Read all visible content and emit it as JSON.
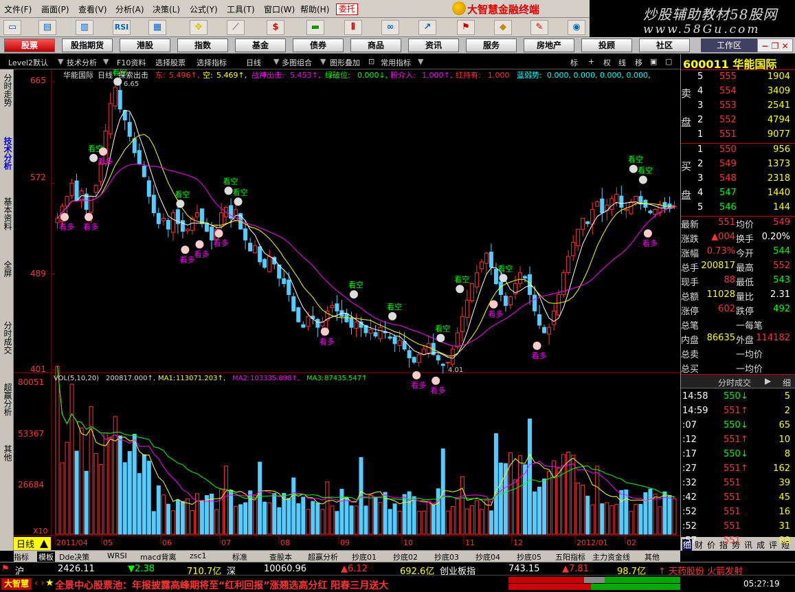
{
  "menu": [
    "文件(F)",
    "画面(P)",
    "查看(V)",
    "分析(A)",
    "决策(L)",
    "公式(Y)",
    "工具(T)",
    "窗口(W)",
    "帮助(H)"
  ],
  "weituo": "委托",
  "brand": "大智慧金融终端",
  "watermark": {
    "line1": "炒股辅助教材58股网",
    "line2": "www.58Gu.com"
  },
  "toolbar_icons": [
    "open-icon",
    "window-icon",
    "kline-icon",
    "rsi-icon",
    "table-icon",
    "move-icon",
    "ruler-icon",
    "dollar-icon",
    "flag-icon",
    "bars-icon",
    "binocular-icon",
    "signal-icon",
    "alert-icon",
    "diamond-icon",
    "shuffle-icon",
    "globe-icon",
    "window2-icon"
  ],
  "toolbar_rsi": "RSI",
  "toolbar_dollar": "$",
  "nav": [
    "股票",
    "股指期货",
    "港股",
    "指数",
    "基金",
    "债券",
    "商品",
    "资讯",
    "服务",
    "房地产",
    "投顾",
    "社区"
  ],
  "workarea": "工作区",
  "subbar": {
    "level2": "Level2默认",
    "tech": "技术分析",
    "f10": "F10资料",
    "select": "选择股票",
    "indicator": "选择指标",
    "day": "日线",
    "multi": "多图组合",
    "overlay": "图形叠加",
    "common": "常用指标",
    "tag": "标",
    "plus": "+",
    "quan": "权",
    "xian": "线",
    "move": "移"
  },
  "left_tabs": [
    "分时走势",
    "技术分析",
    "基本资料",
    "全屏",
    "分时成交",
    "超赢分析",
    "其他"
  ],
  "chart_header": {
    "name": "华能国际",
    "period": "日线",
    "ind1": "探索出击",
    "dong": "东:",
    "dong_v": "5.496↑,",
    "kong": "空:",
    "kong_v": "5.469↑,",
    "zhan": "战神出击:",
    "zhan_v": "5.453↑,",
    "lv": "绿破位:",
    "lv_v": "0.000↓,",
    "fen": "粉介入:",
    "fen_v": "1.000↑,",
    "hong": "红持有:",
    "hong_v": "1.000",
    "lan": "蓝弱势:",
    "lan_v": "0.000, 0.000, 0.000, 0.000,"
  },
  "price_axis": [
    "665",
    "572",
    "489",
    "401"
  ],
  "high_label": "6.65",
  "low_label": "4.01",
  "vol_header": {
    "vol": "VOL(5,10,20)",
    "vol_v": "200817.000↑,",
    "ma1": "MA1:",
    "ma1_v": "113071.203↑,",
    "ma2": "MA2:",
    "ma2_v": "103335.898↑,",
    "ma3": "MA3:",
    "ma3_v": "87435.547↑"
  },
  "vol_axis": [
    "80051",
    "53367",
    "26684"
  ],
  "vol_x10": "X10",
  "date_axis": [
    "2011/04",
    "05",
    "06",
    "07",
    "08",
    "09",
    "10",
    "11",
    "12",
    "2012/01",
    "02"
  ],
  "signals": {
    "bear": "看空",
    "bull": "看多"
  },
  "right": {
    "code": "600011",
    "name": "华能国际",
    "sell_label": [
      "卖",
      "盘"
    ],
    "buy_label": [
      "买",
      "盘"
    ],
    "asks": [
      {
        "n": "5",
        "p": "555",
        "v": "1904"
      },
      {
        "n": "4",
        "p": "554",
        "v": "3409"
      },
      {
        "n": "3",
        "p": "553",
        "v": "2541"
      },
      {
        "n": "2",
        "p": "552",
        "v": "4794"
      },
      {
        "n": "1",
        "p": "551",
        "v": "9077"
      }
    ],
    "bids": [
      {
        "n": "1",
        "p": "550",
        "v": "956"
      },
      {
        "n": "2",
        "p": "549",
        "v": "1373"
      },
      {
        "n": "3",
        "p": "548",
        "v": "2318"
      },
      {
        "n": "4",
        "p": "547",
        "v": "1440"
      },
      {
        "n": "5",
        "p": "546",
        "v": "144"
      }
    ],
    "stats": [
      {
        "l1": "最新",
        "v1": "551",
        "l2": "均价",
        "v2": "549",
        "c1": "red",
        "c2": "red"
      },
      {
        "l1": "涨跌",
        "v1": "▲004",
        "l2": "换手",
        "v2": "0.20%",
        "c1": "red",
        "c2": "wht"
      },
      {
        "l1": "涨幅",
        "v1": "0.73%",
        "l2": "今开",
        "v2": "544",
        "c1": "red",
        "c2": "grn"
      },
      {
        "l1": "总手",
        "v1": "200817",
        "l2": "最高",
        "v2": "552",
        "c1": "yel",
        "c2": "red"
      },
      {
        "l1": "现手",
        "v1": "88",
        "l2": "最低",
        "v2": "543",
        "c1": "red",
        "c2": "grn"
      },
      {
        "l1": "总额",
        "v1": "11028",
        "l2": "量比",
        "v2": "2.31",
        "c1": "yel",
        "c2": "wht"
      },
      {
        "l1": "涨停",
        "v1": "602",
        "l2": "跌停",
        "v2": "492",
        "c1": "red",
        "c2": "grn"
      },
      {
        "l1": "总笔",
        "v1": "",
        "l2": "一每笔",
        "v2": "",
        "c1": "wht",
        "c2": "wht"
      },
      {
        "l1": "内盘",
        "v1": "86635",
        "l2": "外盘",
        "v2": "114182",
        "c1": "yel",
        "c2": "red"
      },
      {
        "l1": "总卖",
        "v1": "",
        "l2": "一均价",
        "v2": "",
        "c1": "wht",
        "c2": "wht"
      },
      {
        "l1": "总买",
        "v1": "",
        "l2": "一均价",
        "v2": "",
        "c1": "wht",
        "c2": "wht"
      }
    ],
    "trades_title": "分时成交",
    "trades_detail": "细",
    "trades": [
      {
        "t": "14:58",
        "p": "550",
        "d": "↓",
        "v": "5"
      },
      {
        "t": "14:59",
        "p": "551",
        "d": "↑",
        "v": "2"
      },
      {
        "t": ":07",
        "p": "550",
        "d": "↓",
        "v": "65"
      },
      {
        "t": ":12",
        "p": "551",
        "d": "↑",
        "v": "10"
      },
      {
        "t": ":17",
        "p": "550",
        "d": "↓",
        "v": "8"
      },
      {
        "t": ":27",
        "p": "551",
        "d": "↑",
        "v": "162"
      },
      {
        "t": ":32",
        "p": "551",
        "d": "",
        "v": "39"
      },
      {
        "t": ":42",
        "p": "551",
        "d": "",
        "v": "45"
      },
      {
        "t": ":52",
        "p": "551",
        "d": "",
        "v": "16"
      },
      {
        "t": ":52",
        "p": "551",
        "d": "",
        "v": "31"
      },
      {
        "t": ":57",
        "p": "551",
        "d": "",
        "v": "88"
      }
    ],
    "bottom_tabs": [
      "细",
      "财",
      "价",
      "指",
      "势",
      "讯",
      "成",
      "评",
      "短"
    ]
  },
  "bottom_tabs": [
    "指标",
    "模板",
    "Dde决策",
    "WRSI",
    "macd背离",
    "zsc1",
    "标准",
    "查股本",
    "超赢分析",
    "抄底01",
    "抄底02",
    "抄底03",
    "抄底04",
    "抄底05",
    "五阳指标",
    "主力资金线",
    "其他"
  ],
  "day_tab": "日线",
  "status": {
    "sh": "沪",
    "sh_v": "2426.11",
    "sh_chg": "▼2.38",
    "sh_amt": "710.7亿",
    "sz": "深",
    "sz_v": "10060.96",
    "sz_chg": "▲6.12",
    "sz_amt": "692.6亿",
    "cyb": "创业板指",
    "cyb_v": "743.15",
    "cyb_chg": "▲7.81",
    "cyb_amt": "98.7亿",
    "news": "天药股份 火箭发射"
  },
  "ticker": {
    "logo": "大智慧",
    "text": "全景中心股票池：年报披露高峰期将至“红利回报”涨翘选高分红 阳春三月送大",
    "clock": "05:2?:19"
  },
  "chart_data": {
    "type": "candlestick",
    "ylim": [
      401,
      665
    ],
    "vol_ylim": [
      0,
      80051
    ],
    "x_labels": [
      "2011/04",
      "05",
      "06",
      "07",
      "08",
      "09",
      "10",
      "11",
      "12",
      "2012/01",
      "02"
    ],
    "close_series": [
      540,
      551,
      560,
      572,
      556,
      565,
      548,
      560,
      570,
      590,
      620,
      645,
      660,
      640,
      630,
      615,
      600,
      590,
      578,
      560,
      545,
      535,
      540,
      530,
      545,
      535,
      528,
      530,
      540,
      545,
      535,
      528,
      520,
      530,
      545,
      550,
      540,
      548,
      530,
      520,
      510,
      515,
      500,
      495,
      505,
      498,
      485,
      480,
      470,
      455,
      445,
      440,
      450,
      448,
      440,
      445,
      455,
      460,
      455,
      450,
      445,
      440,
      445,
      440,
      435,
      438,
      432,
      440,
      435,
      430,
      425,
      428,
      420,
      412,
      408,
      415,
      420,
      425,
      415,
      410,
      405,
      408,
      420,
      435,
      450,
      465,
      480,
      490,
      500,
      508,
      495,
      480,
      470,
      460,
      468,
      480,
      490,
      485,
      470,
      455,
      442,
      435,
      440,
      455,
      470,
      490,
      505,
      518,
      530,
      540,
      535,
      548,
      555,
      545,
      552,
      558,
      562,
      550,
      548,
      555,
      560,
      553,
      550,
      545,
      548,
      552,
      550,
      549,
      551
    ]
  }
}
